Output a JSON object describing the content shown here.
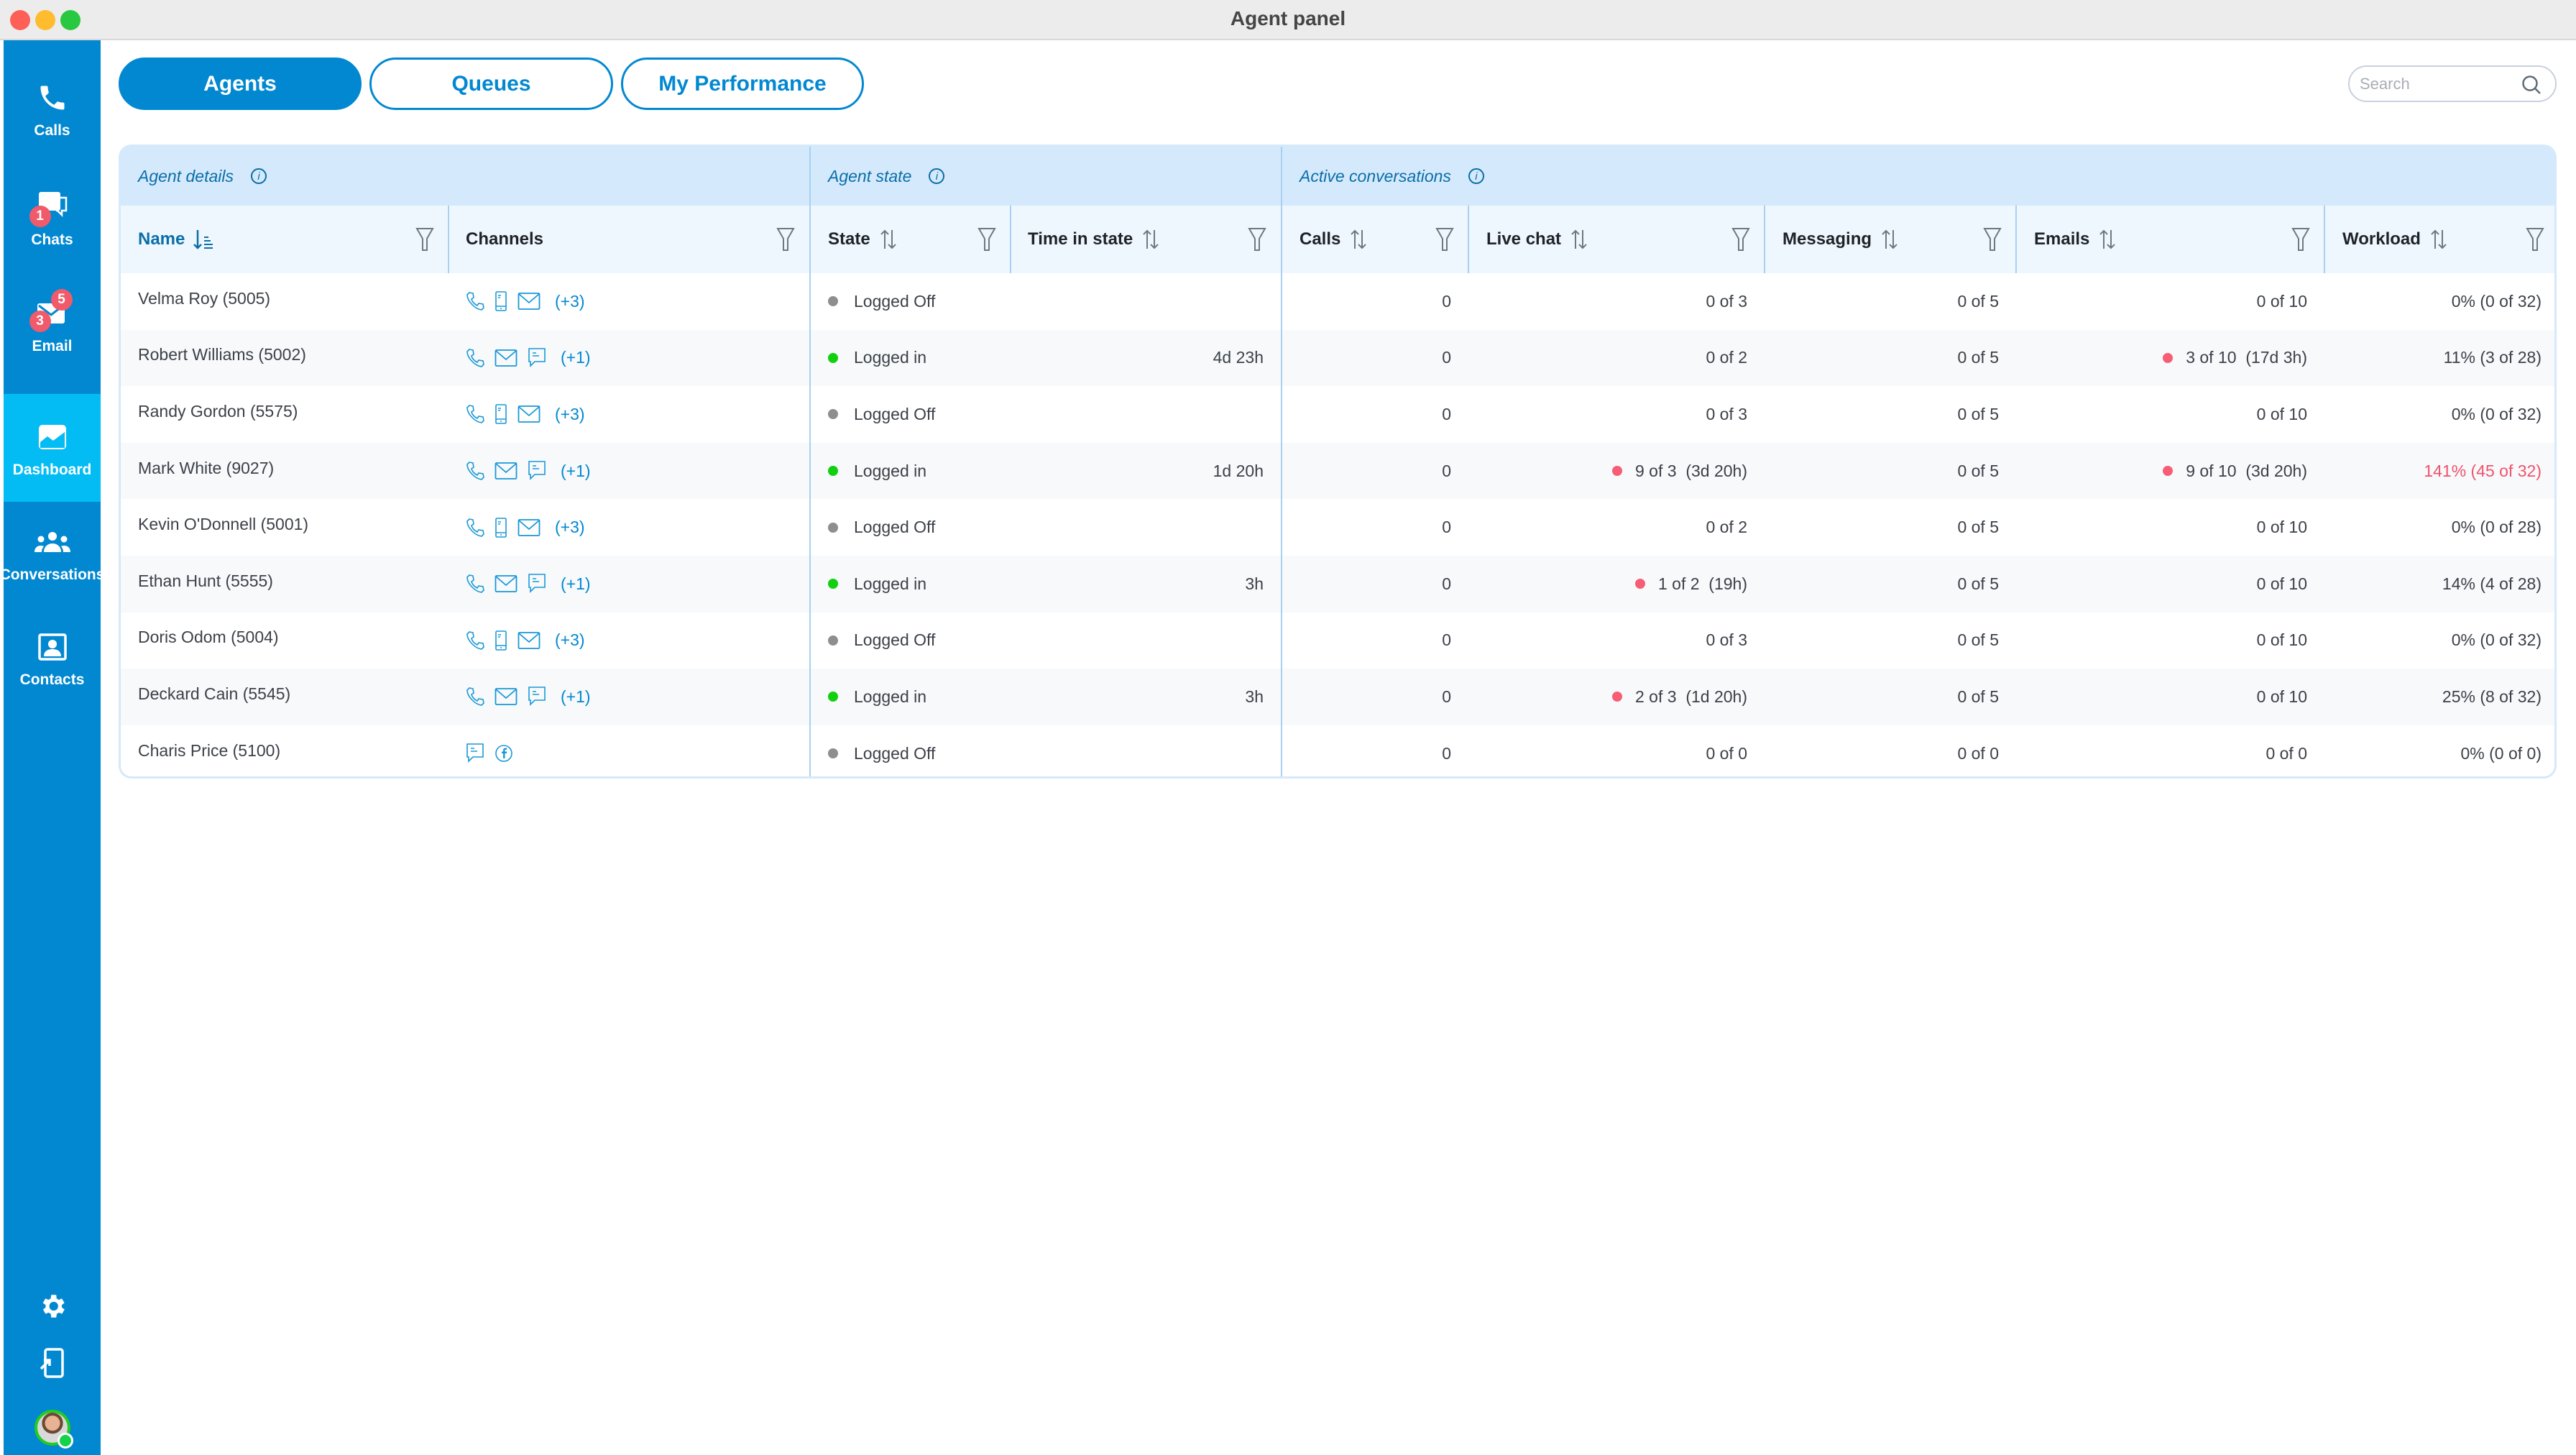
{
  "window": {
    "title": "Agent panel"
  },
  "sidebar": {
    "items": [
      {
        "key": "calls",
        "label": "Calls",
        "icon": "phone-icon"
      },
      {
        "key": "chats",
        "label": "Chats",
        "icon": "chat-icon",
        "badge": "1"
      },
      {
        "key": "email",
        "label": "Email",
        "icon": "email-icon",
        "badge": "5",
        "badge2": "3"
      },
      {
        "key": "dashboard",
        "label": "Dashboard",
        "icon": "dashboard-icon",
        "active": true
      },
      {
        "key": "conversations",
        "label": "Conversations",
        "icon": "people-icon"
      },
      {
        "key": "contacts",
        "label": "Contacts",
        "icon": "contact-card-icon"
      }
    ],
    "bottom": [
      "gear-icon",
      "mobile-login-icon",
      "avatar"
    ]
  },
  "tabs": [
    {
      "label": "Agents",
      "active": true
    },
    {
      "label": "Queues",
      "active": false
    },
    {
      "label": "My Performance",
      "active": false
    }
  ],
  "search": {
    "placeholder": "Search",
    "value": ""
  },
  "table": {
    "groups": [
      {
        "label": "Agent details"
      },
      {
        "label": "Agent state"
      },
      {
        "label": "Active conversations"
      }
    ],
    "columns": [
      {
        "label": "Name",
        "sort": "ascending"
      },
      {
        "label": "Channels"
      },
      {
        "label": "State",
        "sort": "none"
      },
      {
        "label": "Time in state",
        "sort": "none"
      },
      {
        "label": "Calls",
        "sort": "none"
      },
      {
        "label": "Live chat",
        "sort": "none"
      },
      {
        "label": "Messaging",
        "sort": "none"
      },
      {
        "label": "Emails",
        "sort": "none"
      },
      {
        "label": "Workload",
        "sort": "none"
      }
    ],
    "rows": [
      {
        "name": "Velma Roy (5005)",
        "channels": [
          "phone",
          "mobile",
          "email"
        ],
        "more": "(+3)",
        "state": "Logged Off",
        "online": false,
        "time": "",
        "calls": "0",
        "livechat": "0 of 3",
        "livechat_alert": false,
        "messaging": "0 of 5",
        "emails": "0 of 10",
        "emails_alert": false,
        "workload": "0% (0 of 32)",
        "workload_over": false
      },
      {
        "name": "Robert Williams (5002)",
        "channels": [
          "phone",
          "email",
          "chat"
        ],
        "more": "(+1)",
        "state": "Logged in",
        "online": true,
        "time": "4d 23h",
        "calls": "0",
        "livechat": "0 of 2",
        "livechat_alert": false,
        "messaging": "0 of 5",
        "emails": "3 of 10  (17d 3h)",
        "emails_alert": true,
        "workload": "11% (3 of 28)",
        "workload_over": false
      },
      {
        "name": "Randy Gordon (5575)",
        "channels": [
          "phone",
          "mobile",
          "email"
        ],
        "more": "(+3)",
        "state": "Logged Off",
        "online": false,
        "time": "",
        "calls": "0",
        "livechat": "0 of 3",
        "livechat_alert": false,
        "messaging": "0 of 5",
        "emails": "0 of 10",
        "emails_alert": false,
        "workload": "0% (0 of 32)",
        "workload_over": false
      },
      {
        "name": "Mark White (9027)",
        "channels": [
          "phone",
          "email",
          "chat"
        ],
        "more": "(+1)",
        "state": "Logged in",
        "online": true,
        "time": "1d 20h",
        "calls": "0",
        "livechat": "9 of 3  (3d 20h)",
        "livechat_alert": true,
        "messaging": "0 of 5",
        "emails": "9 of 10  (3d 20h)",
        "emails_alert": true,
        "workload": "141% (45 of 32)",
        "workload_over": true
      },
      {
        "name": "Kevin O'Donnell (5001)",
        "channels": [
          "phone",
          "mobile",
          "email"
        ],
        "more": "(+3)",
        "state": "Logged Off",
        "online": false,
        "time": "",
        "calls": "0",
        "livechat": "0 of 2",
        "livechat_alert": false,
        "messaging": "0 of 5",
        "emails": "0 of 10",
        "emails_alert": false,
        "workload": "0% (0 of 28)",
        "workload_over": false
      },
      {
        "name": "Ethan Hunt (5555)",
        "channels": [
          "phone",
          "email",
          "chat"
        ],
        "more": "(+1)",
        "state": "Logged in",
        "online": true,
        "time": "3h",
        "calls": "0",
        "livechat": "1 of 2  (19h)",
        "livechat_alert": true,
        "messaging": "0 of 5",
        "emails": "0 of 10",
        "emails_alert": false,
        "workload": "14% (4 of 28)",
        "workload_over": false
      },
      {
        "name": "Doris Odom (5004)",
        "channels": [
          "phone",
          "mobile",
          "email"
        ],
        "more": "(+3)",
        "state": "Logged Off",
        "online": false,
        "time": "",
        "calls": "0",
        "livechat": "0 of 3",
        "livechat_alert": false,
        "messaging": "0 of 5",
        "emails": "0 of 10",
        "emails_alert": false,
        "workload": "0% (0 of 32)",
        "workload_over": false
      },
      {
        "name": "Deckard Cain (5545)",
        "channels": [
          "phone",
          "email",
          "chat"
        ],
        "more": "(+1)",
        "state": "Logged in",
        "online": true,
        "time": "3h",
        "calls": "0",
        "livechat": "2 of 3  (1d 20h)",
        "livechat_alert": true,
        "messaging": "0 of 5",
        "emails": "0 of 10",
        "emails_alert": false,
        "workload": "25% (8 of 32)",
        "workload_over": false
      },
      {
        "name": "Charis Price (5100)",
        "channels": [
          "chat",
          "facebook"
        ],
        "more": "",
        "state": "Logged Off",
        "online": false,
        "time": "",
        "calls": "0",
        "livechat": "0 of 0",
        "livechat_alert": false,
        "messaging": "0 of 0",
        "emails": "0 of 0",
        "emails_alert": false,
        "workload": "0% (0 of 0)",
        "workload_over": false
      }
    ]
  },
  "colors": {
    "brand": "#0288d1",
    "active_nav": "#03bcf4",
    "online": "#10d010",
    "offline": "#8e8e8e",
    "alert": "#f75d75"
  }
}
